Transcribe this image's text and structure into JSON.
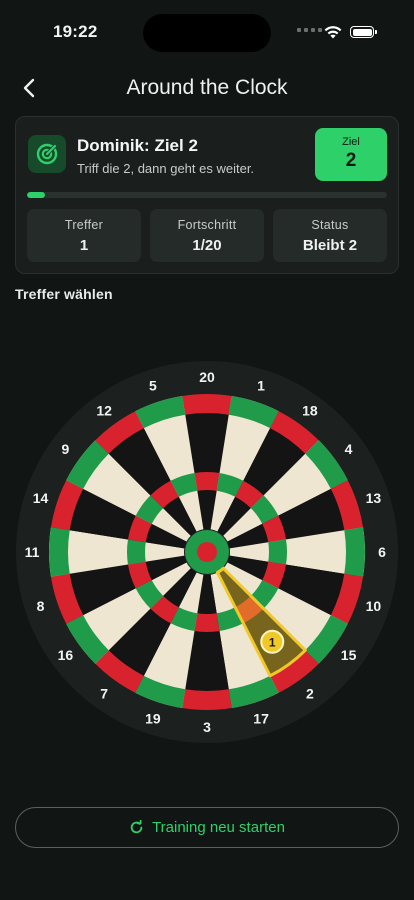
{
  "status_bar": {
    "time": "19:22"
  },
  "header": {
    "title": "Around the Clock"
  },
  "player": {
    "name": "Dominik: Ziel 2",
    "hint": "Triff die 2, dann geht es weiter."
  },
  "target": {
    "label": "Ziel",
    "value": "2"
  },
  "progress": {
    "fraction": 0.05
  },
  "stats": [
    {
      "label": "Treffer",
      "value": "1"
    },
    {
      "label": "Fortschritt",
      "value": "1/20"
    },
    {
      "label": "Status",
      "value": "Bleibt 2"
    }
  ],
  "section_title": "Treffer wählen",
  "dartboard": {
    "numbers": [
      20,
      1,
      18,
      4,
      13,
      6,
      10,
      15,
      2,
      17,
      3,
      19,
      7,
      16,
      8,
      11,
      14,
      9,
      12,
      5
    ],
    "hit_segment": 2,
    "hit_marker": "1"
  },
  "colors": {
    "accent": "#2ed06a",
    "red": "#d8232f",
    "green": "#1f9b4a",
    "cream": "#efe6d2",
    "black": "#141414"
  },
  "restart_button": {
    "label": "Training neu starten",
    "icon": "refresh-icon"
  }
}
